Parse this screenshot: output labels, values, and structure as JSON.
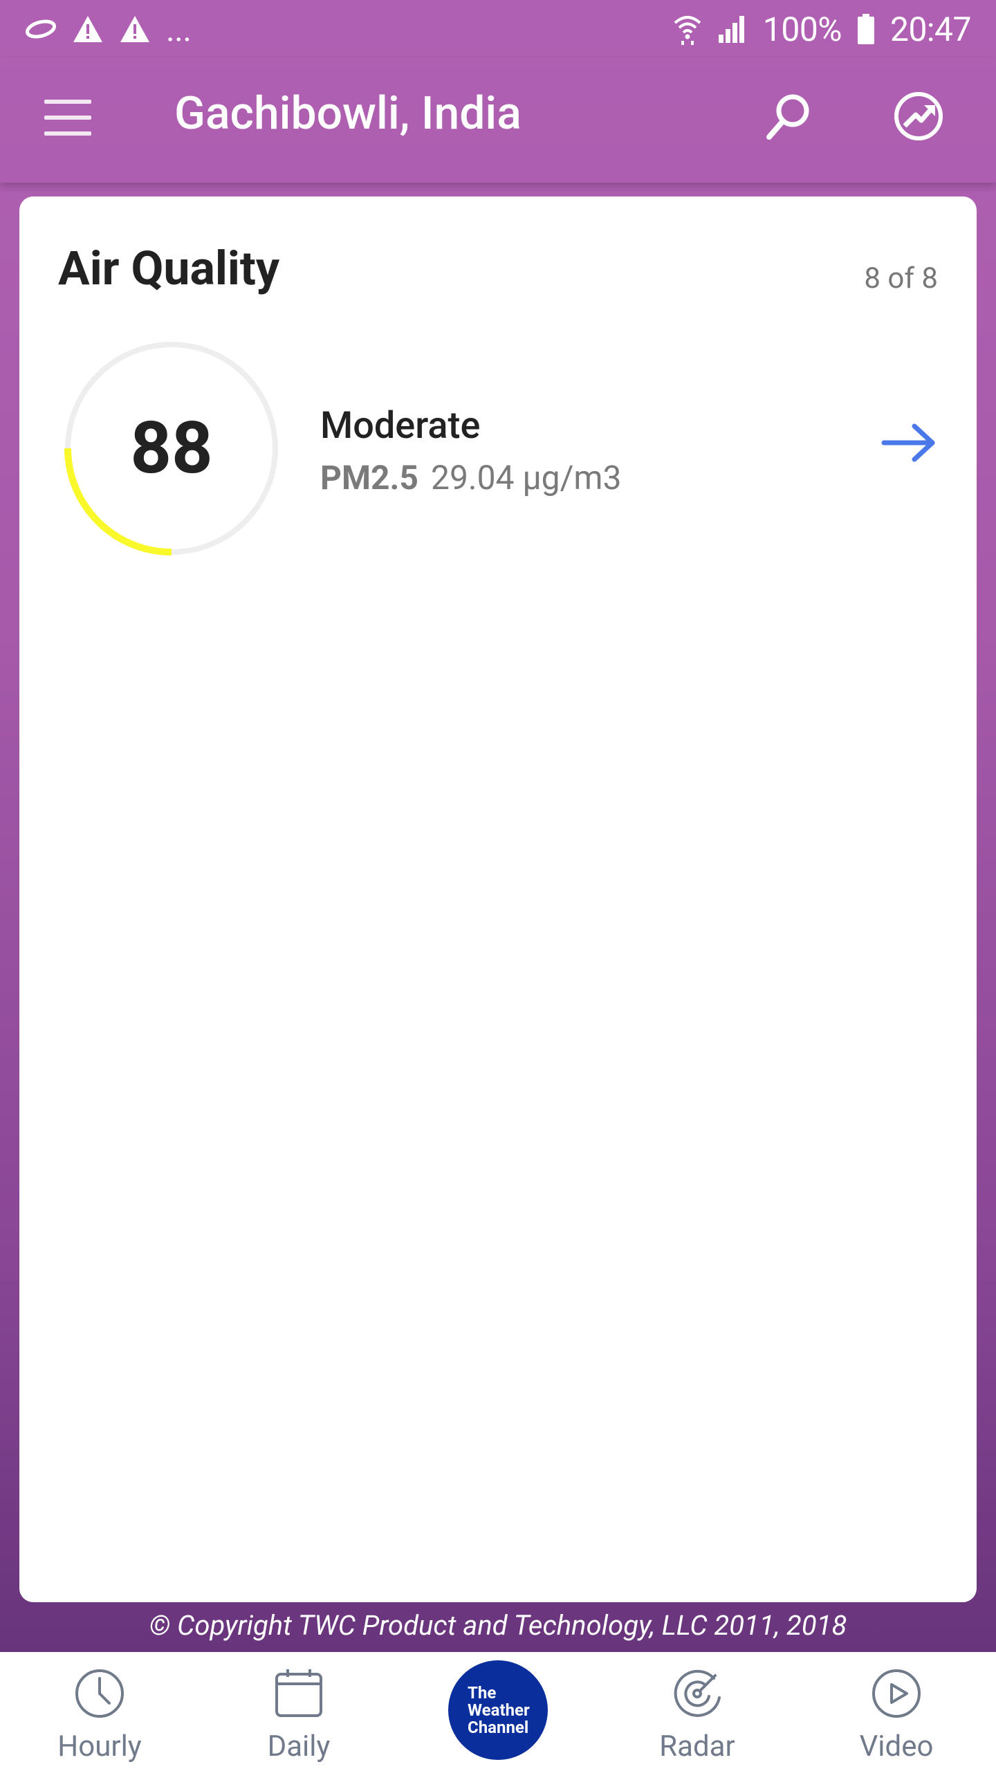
{
  "status_bar": {
    "battery": "100%",
    "time": "20:47",
    "overflow": "..."
  },
  "app_bar": {
    "title": "Gachibowli, India"
  },
  "card": {
    "title": "Air Quality",
    "count": "8 of 8",
    "aqi_value": "88",
    "aqi_level": 0.25,
    "category": "Moderate",
    "pollutant_name": "PM2.5",
    "pollutant_value": "29.04 µg/m3",
    "ring_color": "#f8f82a",
    "arrow_color": "#4a78e8"
  },
  "footer": {
    "copyright": "© Copyright TWC Product and Technology, LLC 2011, 2018"
  },
  "bottom_nav": {
    "items": [
      {
        "label": "Hourly",
        "icon": "clock-icon"
      },
      {
        "label": "Daily",
        "icon": "calendar-icon"
      },
      {
        "label": "",
        "icon": "the-weather-channel-logo"
      },
      {
        "label": "Radar",
        "icon": "radar-icon"
      },
      {
        "label": "Video",
        "icon": "play-icon"
      }
    ],
    "logo_text": [
      "The",
      "Weather",
      "Channel"
    ]
  },
  "colors": {
    "header": "#b060b2",
    "logo_bg": "#0a2f9c"
  }
}
